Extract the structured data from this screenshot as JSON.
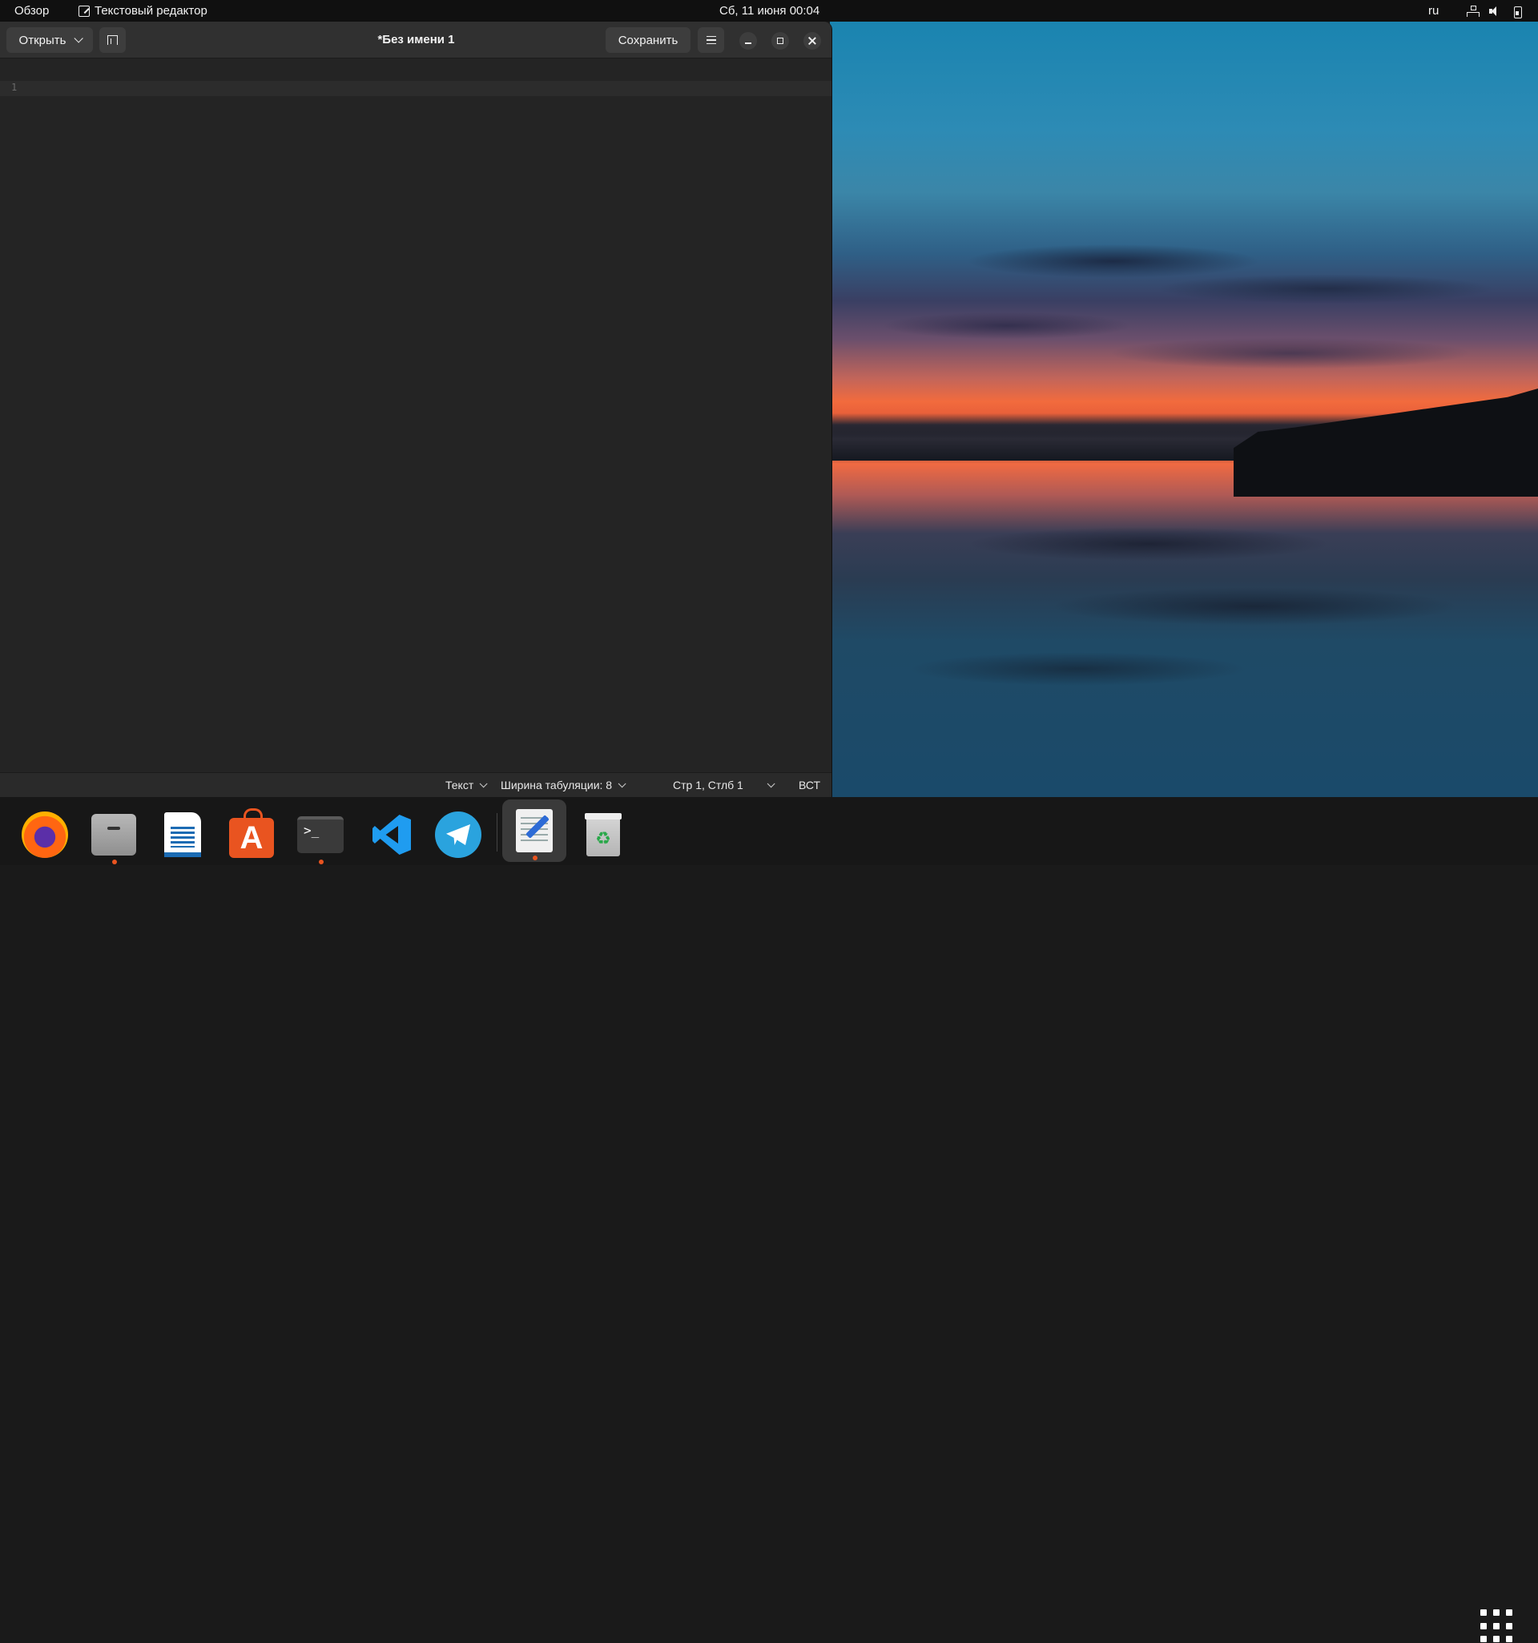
{
  "topbar": {
    "overview": "Обзор",
    "app_name": "Текстовый редактор",
    "app_icon": "text-editor-icon",
    "clock": "Сб, 11 июня  00:04",
    "lang": "ru",
    "icons": [
      "network-icon",
      "volume-icon",
      "battery-icon"
    ]
  },
  "window": {
    "open_label": "Открыть",
    "save_label": "Сохранить",
    "title": "*Без имени 1",
    "line_number": "1"
  },
  "statusbar": {
    "language": "Текст",
    "tab_width": "Ширина табуляции: 8",
    "position": "Стр 1, Стлб 1",
    "insert_mode": "ВСТ"
  },
  "dock": {
    "items": [
      {
        "name": "Firefox",
        "icon": "firefox-icon",
        "running": false
      },
      {
        "name": "Files",
        "icon": "files-icon",
        "running": true
      },
      {
        "name": "LibreOffice Writer",
        "icon": "writer-icon",
        "running": false
      },
      {
        "name": "Ubuntu Software",
        "icon": "software-store-icon",
        "running": false
      },
      {
        "name": "Terminal",
        "icon": "terminal-icon",
        "running": true
      },
      {
        "name": "Visual Studio Code",
        "icon": "vscode-icon",
        "running": false
      },
      {
        "name": "Telegram",
        "icon": "telegram-icon",
        "running": false
      },
      {
        "name": "Text Editor",
        "icon": "text-editor-icon",
        "running": true,
        "active": true
      },
      {
        "name": "Trash",
        "icon": "trash-icon",
        "running": false
      }
    ],
    "terminal_glyph": ">_",
    "store_glyph": "A",
    "trash_glyph": "♻"
  },
  "colors": {
    "accent": "#e95420",
    "window_bg": "#242424",
    "headerbar_bg": "#303030"
  }
}
